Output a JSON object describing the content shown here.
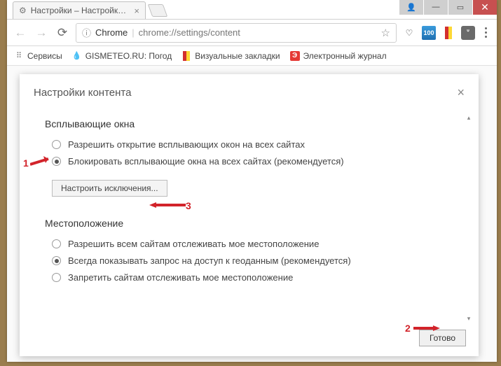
{
  "window": {
    "tab_title": "Настройки – Настройки…",
    "omnibox": {
      "brand": "Chrome",
      "url": "chrome://settings/content"
    }
  },
  "bookmarks": {
    "apps": "Сервисы",
    "gismeteo": "GISMETEO.RU: Погод",
    "yandex_bm": "Визуальные закладки",
    "ej": "Электронный журнал"
  },
  "dialog": {
    "title": "Настройки контента",
    "popups": {
      "heading": "Всплывающие окна",
      "allow": "Разрешить открытие всплывающих окон на всех сайтах",
      "block": "Блокировать всплывающие окна на всех сайтах (рекомендуется)",
      "exceptions_btn": "Настроить исключения..."
    },
    "location": {
      "heading": "Местоположение",
      "allow": "Разрешить всем сайтам отслеживать мое местоположение",
      "ask": "Всегда показывать запрос на доступ к геоданным (рекомендуется)",
      "deny": "Запретить сайтам отслеживать мое местоположение"
    },
    "done": "Готово"
  },
  "annotations": {
    "n1": "1",
    "n2": "2",
    "n3": "3"
  }
}
